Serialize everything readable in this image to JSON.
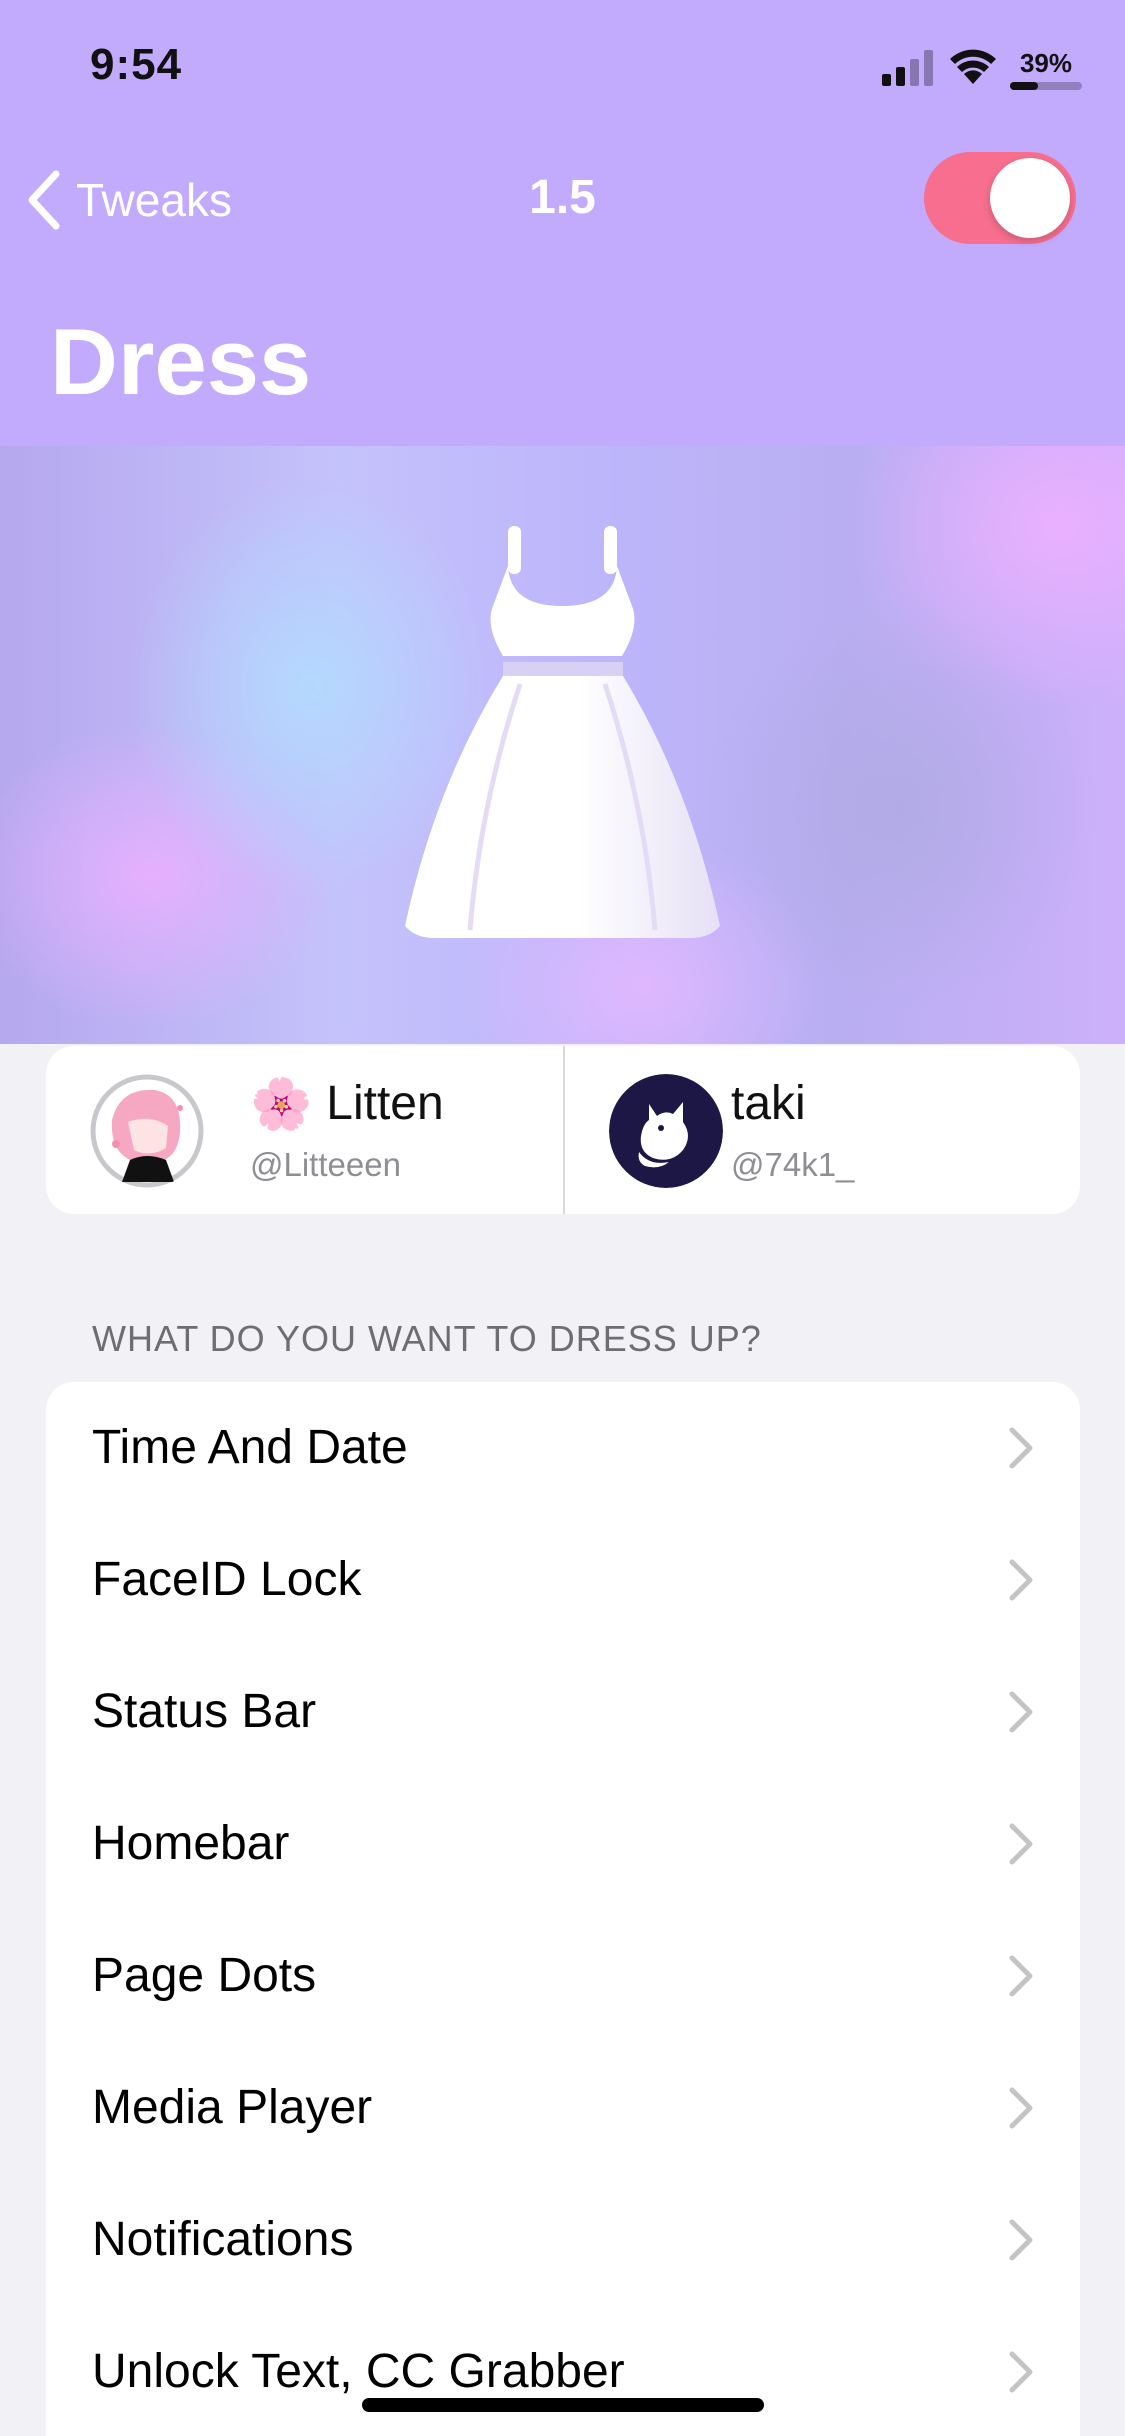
{
  "status_bar": {
    "time": "9:54",
    "battery_percent": "39%",
    "battery_level": 0.39
  },
  "nav": {
    "back_label": "Tweaks",
    "version": "1.5",
    "toggle_on": true,
    "toggle_color": "#f76e8e"
  },
  "page": {
    "title": "Dress",
    "header_color": "#c2abfd"
  },
  "banner": {
    "icon": "dress-icon"
  },
  "authors": [
    {
      "emoji": "🌸",
      "name": "Litten",
      "handle": "@Litteeen"
    },
    {
      "name": "taki",
      "handle": "@74k1_"
    }
  ],
  "section": {
    "header": "WHAT DO YOU WANT TO DRESS UP?"
  },
  "menu_items": [
    {
      "label": "Time And Date"
    },
    {
      "label": "FaceID Lock"
    },
    {
      "label": "Status Bar"
    },
    {
      "label": "Homebar"
    },
    {
      "label": "Page Dots"
    },
    {
      "label": "Media Player"
    },
    {
      "label": "Notifications"
    },
    {
      "label": "Unlock Text, CC Grabber"
    }
  ]
}
